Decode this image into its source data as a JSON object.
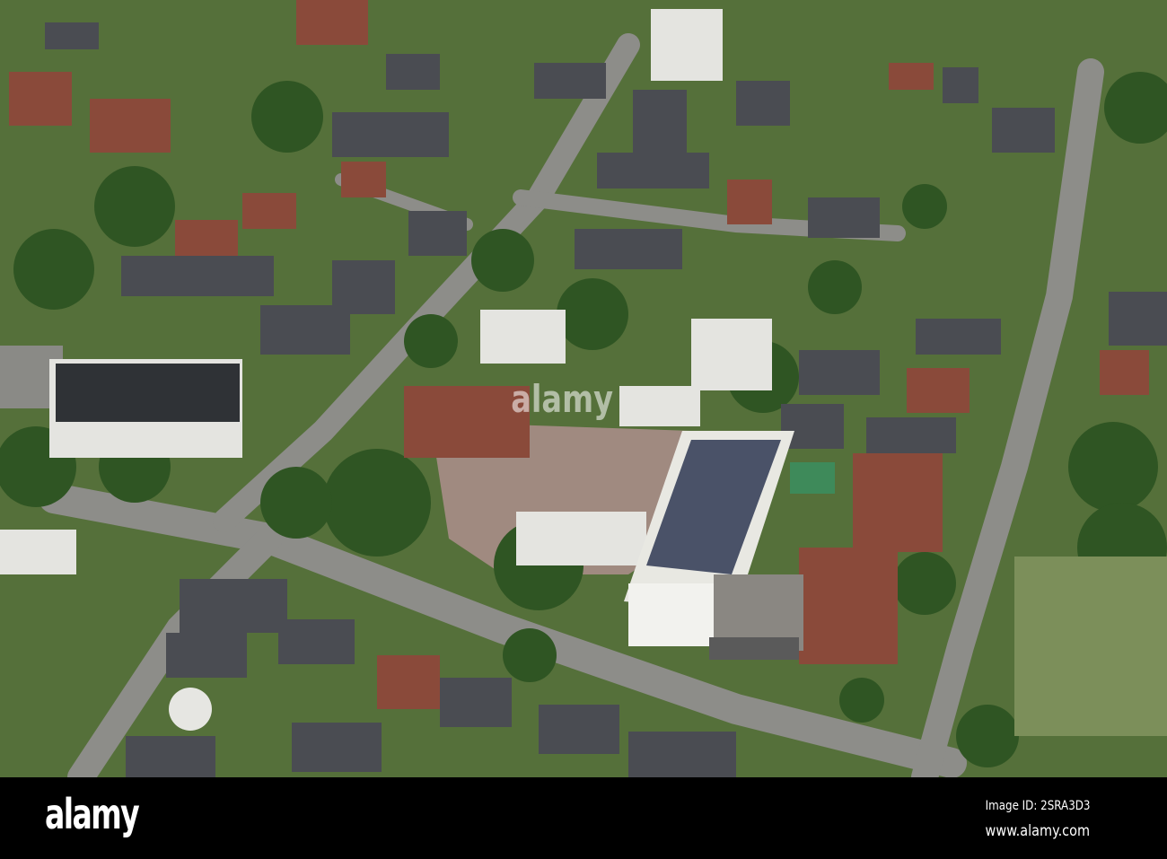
{
  "photo": {
    "subject": "aerial-view-residential-district-with-school",
    "colors": {
      "grass": "#5c7a3a",
      "tree": "#2f5523",
      "road": "#8c8c88",
      "roof_red": "#8a4a3a",
      "roof_dark": "#4a4c52",
      "roof_white": "#e6e6e2",
      "solar": "#4a5268"
    }
  },
  "watermark": {
    "center_text": "alamy"
  },
  "footer": {
    "logo": "alamy",
    "image_id": "Image ID: 2SRA3D3",
    "url": "www.alamy.com"
  }
}
